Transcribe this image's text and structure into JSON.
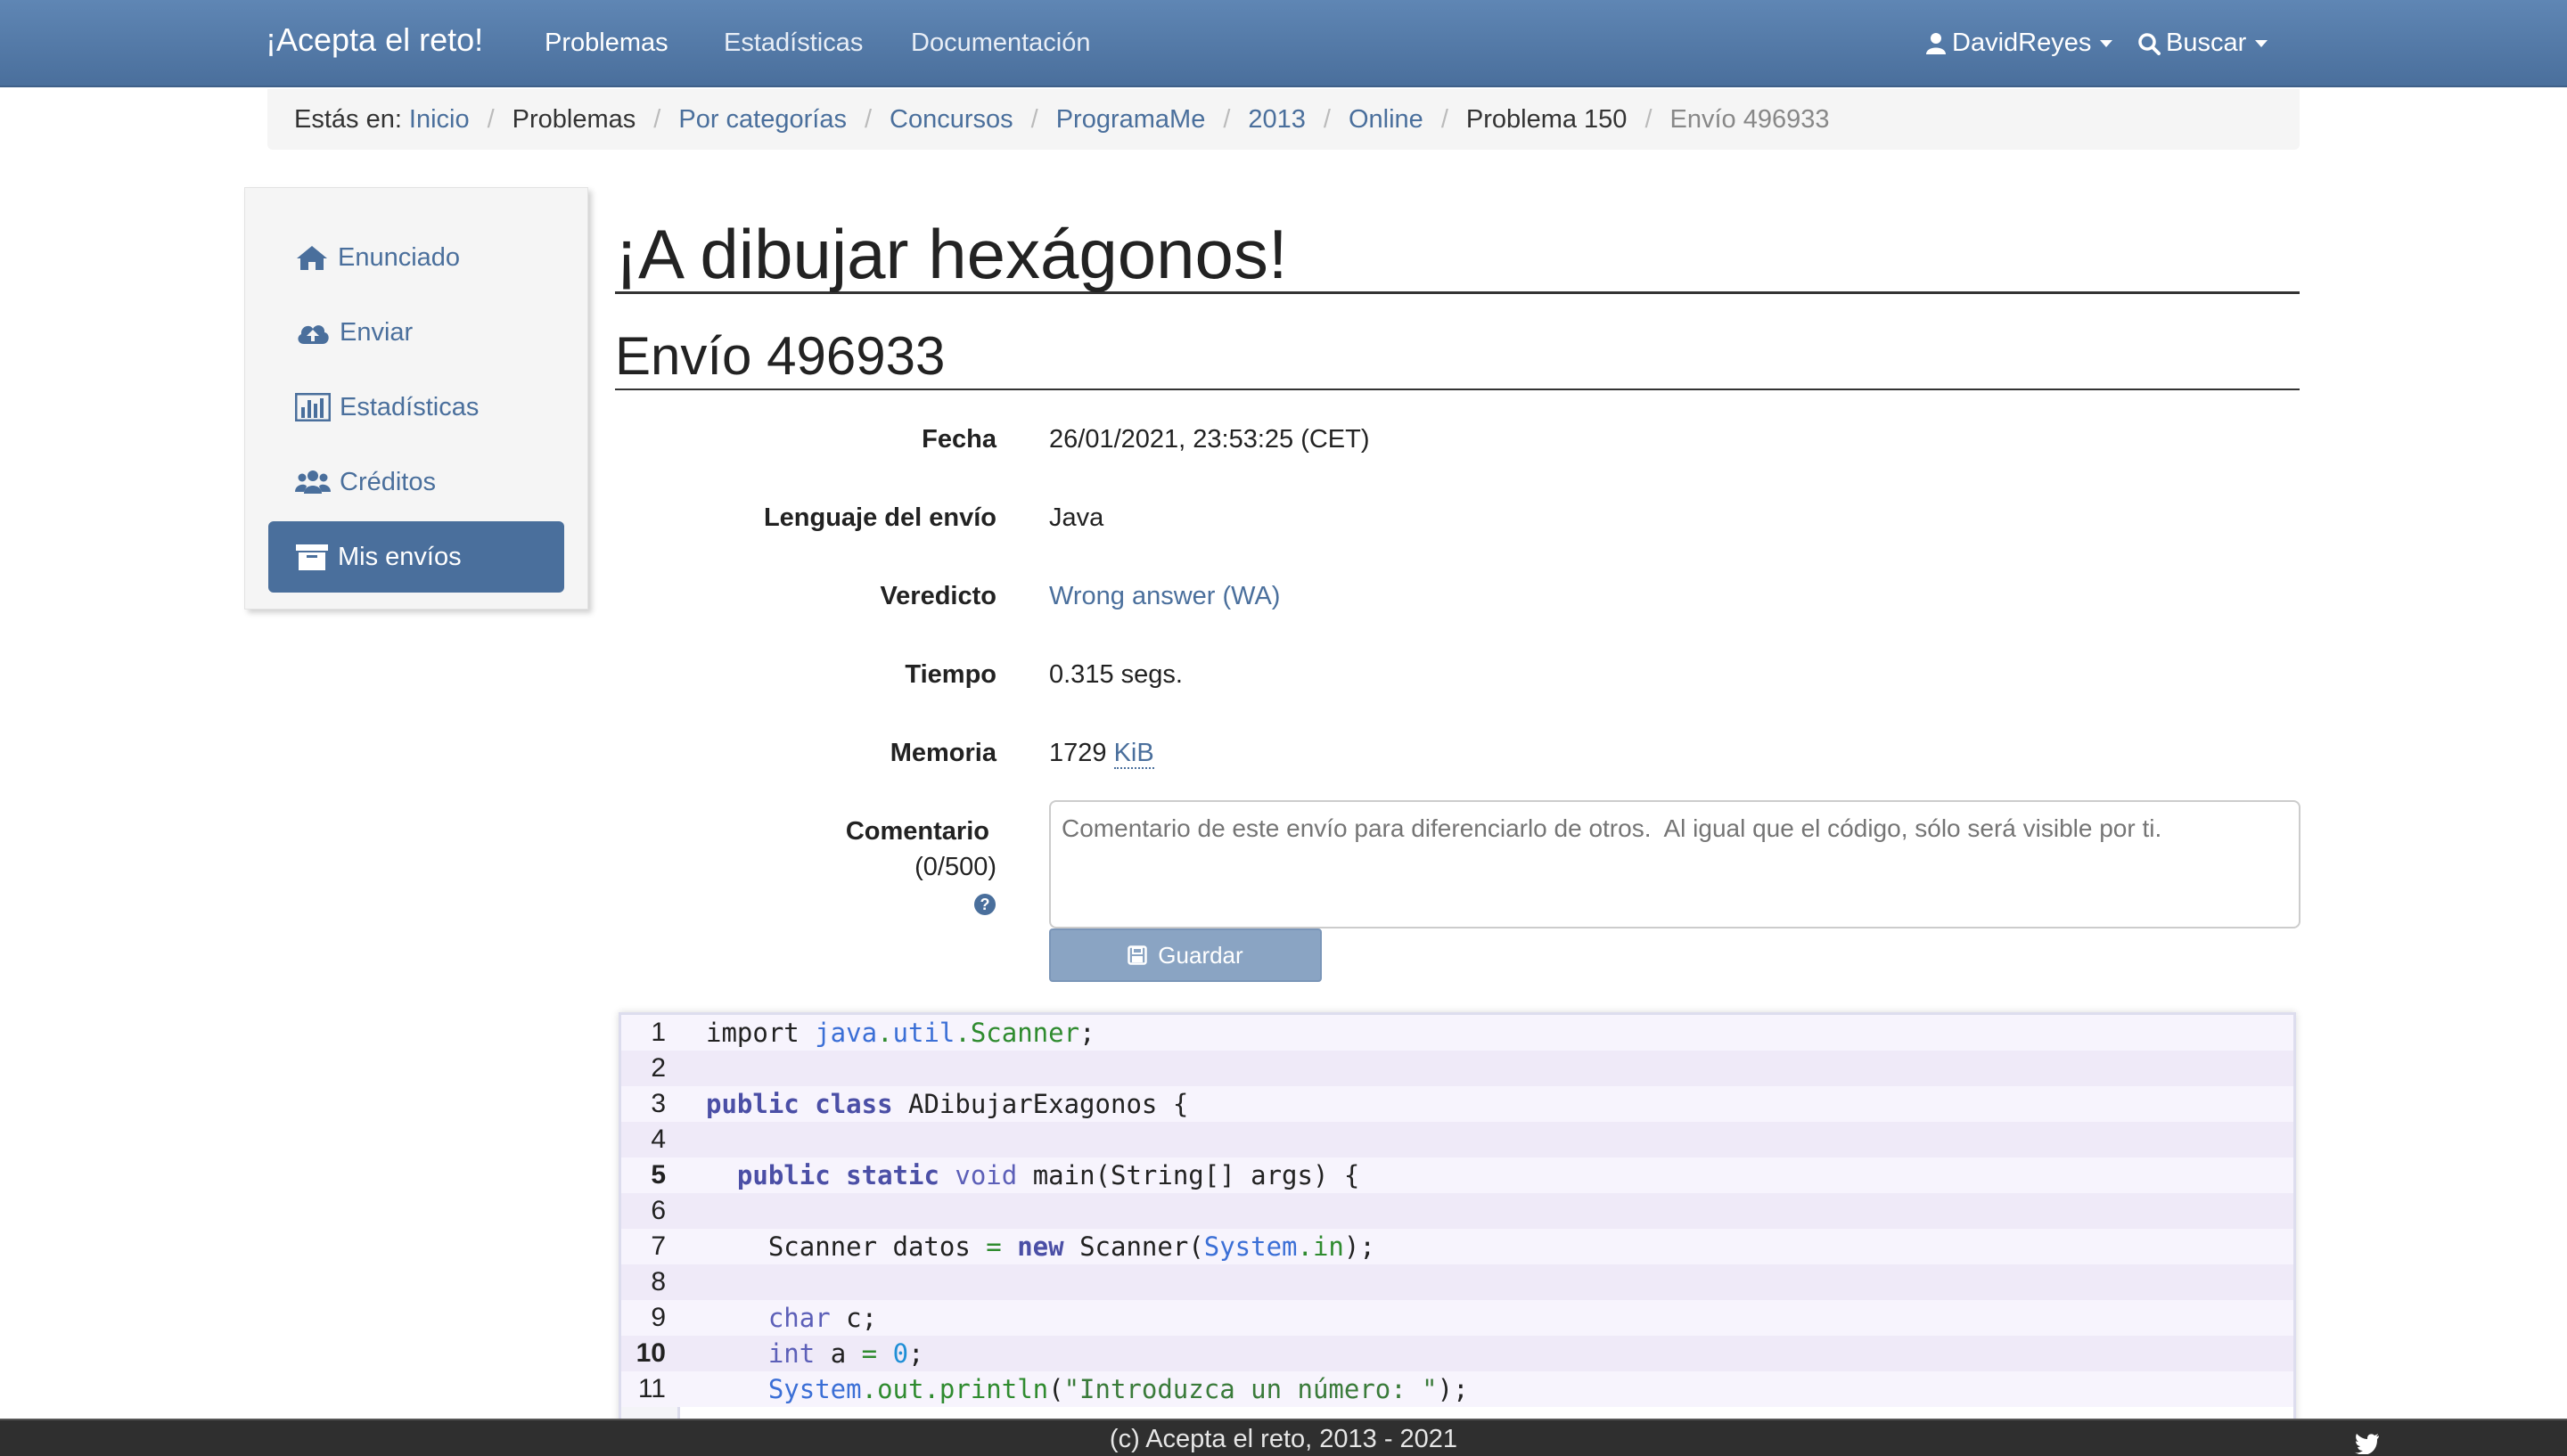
{
  "navbar": {
    "brand": "¡Acepta el reto!",
    "links": [
      "Problemas",
      "Estadísticas",
      "Documentación"
    ],
    "user": "DavidReyes",
    "search": "Buscar"
  },
  "breadcrumb": {
    "prefix": "Estás en:",
    "items": [
      "Inicio",
      "Problemas",
      "Por categorías",
      "Concursos",
      "ProgramaMe",
      "2013",
      "Online",
      "Problema 150",
      "Envío 496933"
    ]
  },
  "sidebar": {
    "items": [
      "Enunciado",
      "Enviar",
      "Estadísticas",
      "Créditos",
      "Mis envíos"
    ]
  },
  "main": {
    "title": "¡A dibujar hexágonos!",
    "subtitle": "Envío 496933",
    "fields": {
      "fecha_label": "Fecha",
      "fecha_value": "26/01/2021, 23:53:25 (CET)",
      "lenguaje_label": "Lenguaje del envío",
      "lenguaje_value": "Java",
      "veredicto_label": "Veredicto",
      "veredicto_value": "Wrong answer (WA)",
      "tiempo_label": "Tiempo",
      "tiempo_value": "0.315 segs.",
      "memoria_label": "Memoria",
      "memoria_value": "1729",
      "memoria_unit": "KiB",
      "comentario_label": "Comentario",
      "comentario_count": "(0/500)",
      "comentario_placeholder": "Comentario de este envío para diferenciarlo de otros.  Al igual que el código, sólo será visible por ti.",
      "save_label": "Guardar"
    }
  },
  "code": {
    "line_numbers": [
      "1",
      "2",
      "3",
      "4",
      "5",
      "6",
      "7",
      "8",
      "9",
      "10",
      "11"
    ]
  },
  "footer": {
    "text": "(c) Acepta el reto, 2013 - 2021"
  }
}
